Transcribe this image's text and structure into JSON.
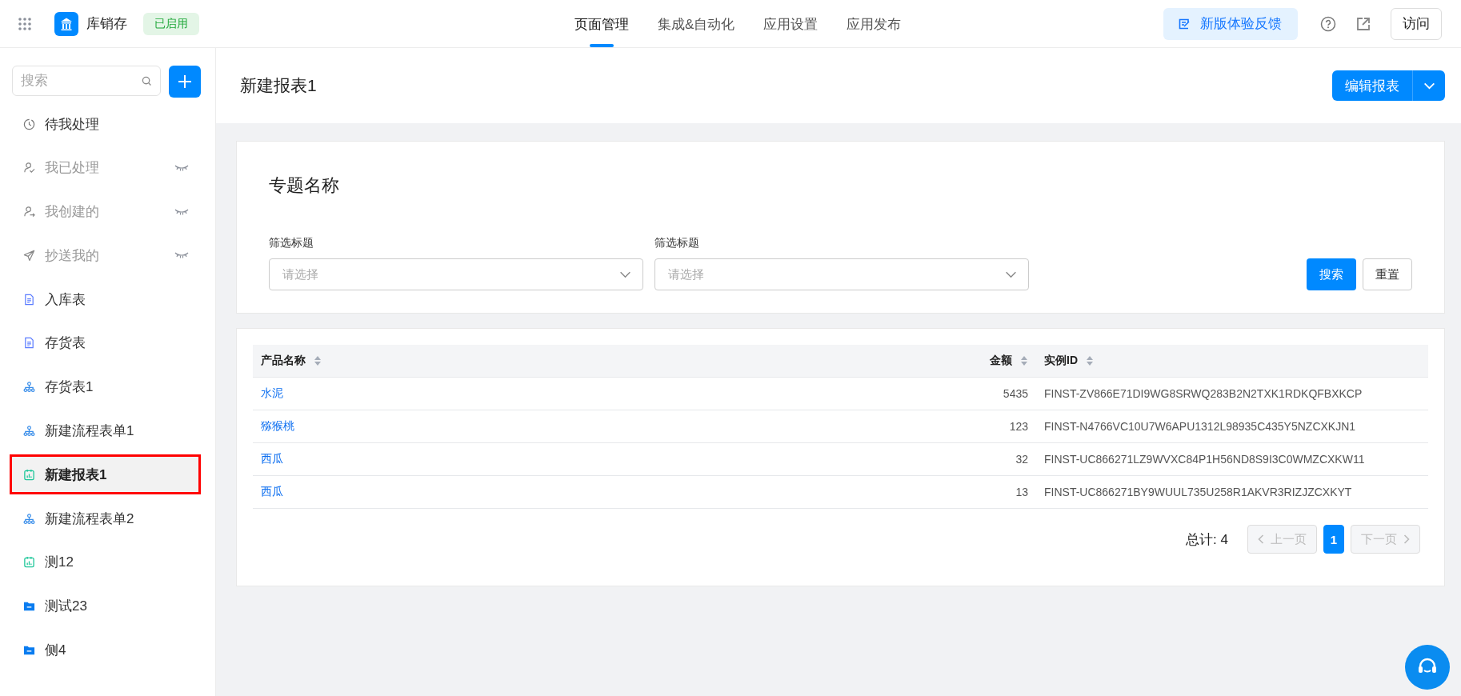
{
  "top_bar": {
    "app_name": "库销存",
    "status_badge": "已启用",
    "nav_tabs": [
      {
        "label": "页面管理",
        "selected": true
      },
      {
        "label": "集成&自动化",
        "selected": false
      },
      {
        "label": "应用设置",
        "selected": false
      },
      {
        "label": "应用发布",
        "selected": false
      }
    ],
    "feedback_button": "新版体验反馈",
    "visit_button": "访问"
  },
  "sidebar": {
    "search": {
      "placeholder": "搜索"
    },
    "items": [
      {
        "label": "待我处理",
        "kind": "pending",
        "hidden": false,
        "selected": false
      },
      {
        "label": "我已处理",
        "kind": "done",
        "hidden": true,
        "selected": false
      },
      {
        "label": "我创建的",
        "kind": "created",
        "hidden": true,
        "selected": false
      },
      {
        "label": "抄送我的",
        "kind": "cc",
        "hidden": true,
        "selected": false
      },
      {
        "label": "入库表",
        "kind": "form",
        "hidden": false,
        "selected": false
      },
      {
        "label": "存货表",
        "kind": "form",
        "hidden": false,
        "selected": false
      },
      {
        "label": "存货表1",
        "kind": "flow",
        "hidden": false,
        "selected": false
      },
      {
        "label": "新建流程表单1",
        "kind": "flow",
        "hidden": false,
        "selected": false
      },
      {
        "label": "新建报表1",
        "kind": "report",
        "hidden": false,
        "selected": true
      },
      {
        "label": "新建流程表单2",
        "kind": "flow",
        "hidden": false,
        "selected": false
      },
      {
        "label": "测12",
        "kind": "report",
        "hidden": false,
        "selected": false
      },
      {
        "label": "测试23",
        "kind": "folder",
        "hidden": false,
        "selected": false
      },
      {
        "label": "侧4",
        "kind": "folder",
        "hidden": false,
        "selected": false
      }
    ]
  },
  "page": {
    "title": "新建报表1",
    "edit_button": "编辑报表"
  },
  "filter": {
    "title": "专题名称",
    "fields": [
      {
        "label": "筛选标题",
        "placeholder": "请选择"
      },
      {
        "label": "筛选标题",
        "placeholder": "请选择"
      }
    ],
    "search_button": "搜索",
    "reset_button": "重置"
  },
  "table": {
    "columns": [
      {
        "label": "产品名称",
        "kind": "text"
      },
      {
        "label": "金额",
        "kind": "number"
      },
      {
        "label": "实例ID",
        "kind": "text"
      }
    ],
    "rows": [
      [
        "水泥",
        "5435",
        "FINST-ZV866E71DI9WG8SRWQ283B2N2TXK1RDKQFBXKCP"
      ],
      [
        "猕猴桃",
        "123",
        "FINST-N4766VC10U7W6APU1312L98935C435Y5NZCXKJN1"
      ],
      [
        "西瓜",
        "32",
        "FINST-UC866271LZ9WVXC84P1H56ND8S9I3C0WMZCXKW11"
      ],
      [
        "西瓜",
        "13",
        "FINST-UC866271BY9WUUL735U258R1AKVR3RIZJZCXKYT"
      ]
    ],
    "total": "总计: 4",
    "pagination": {
      "prev": "上一页",
      "prev_disabled": true,
      "pages": [
        {
          "label": "1",
          "selected": true
        }
      ],
      "next": "下一页",
      "next_disabled": true
    }
  }
}
